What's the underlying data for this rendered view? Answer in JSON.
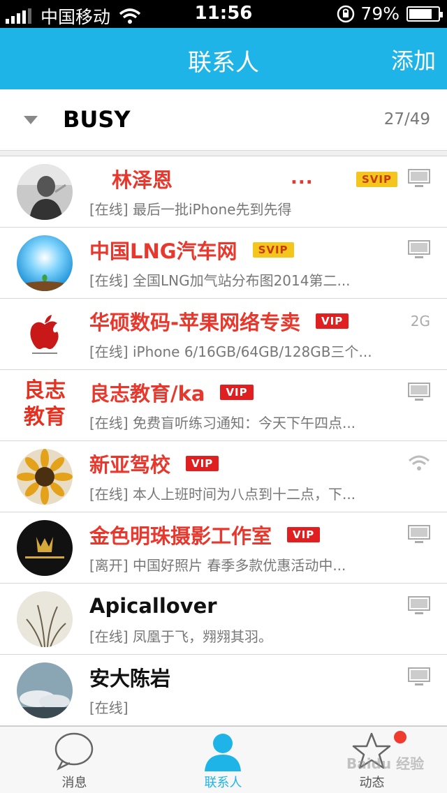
{
  "status_bar": {
    "carrier": "中国移动",
    "time": "11:56",
    "battery": "79%",
    "battery_level": 0.79
  },
  "nav": {
    "title": "联系人",
    "add_label": "添加"
  },
  "group": {
    "name": "BUSY",
    "count": "27/49"
  },
  "contacts": [
    {
      "name": "林泽恩",
      "status": "[在线] 最后一批iPhone先到先得",
      "badge": "SVIP",
      "device": "desktop-icon",
      "extra": "..."
    },
    {
      "name": "中国LNG汽车网",
      "status": "[在线] 全国LNG加气站分布图2014第二...",
      "badge": "SVIP",
      "device": "desktop-icon"
    },
    {
      "name": "华硕数码-苹果网络专卖",
      "status": "[在线] iPhone 6/16GB/64GB/128GB三个...",
      "badge": "VIP",
      "device_text": "2G"
    },
    {
      "name": "良志教育/ka",
      "status": "[在线] 免费盲听练习通知：今天下午四点...",
      "badge": "VIP",
      "device": "desktop-icon"
    },
    {
      "name": "新亚驾校",
      "status": "[在线] 本人上班时间为八点到十二点，下...",
      "badge": "VIP",
      "device": "wifi-icon"
    },
    {
      "name": "金色明珠摄影工作室",
      "status": "[离开] 中国好照片 春季多款优惠活动中...",
      "badge": "VIP",
      "device": "desktop-icon"
    },
    {
      "name": "Apicallover",
      "status": "[在线] 凤凰于飞，翙翙其羽。",
      "device": "desktop-icon"
    },
    {
      "name": "安大陈岩",
      "status": "[在线]",
      "device": "desktop-icon"
    }
  ],
  "tabs": [
    {
      "label": "消息",
      "icon": "chat-bubble-icon"
    },
    {
      "label": "联系人",
      "icon": "person-icon"
    },
    {
      "label": "动态",
      "icon": "star-icon"
    }
  ],
  "avatar_logos": {
    "liangzhi_line1": "良志",
    "liangzhi_line2": "教育"
  },
  "watermark": "Baidu 经验",
  "colors": {
    "accent": "#1fb4e8",
    "vip_red": "#e8382d",
    "svip_gold": "#f4c51c"
  }
}
